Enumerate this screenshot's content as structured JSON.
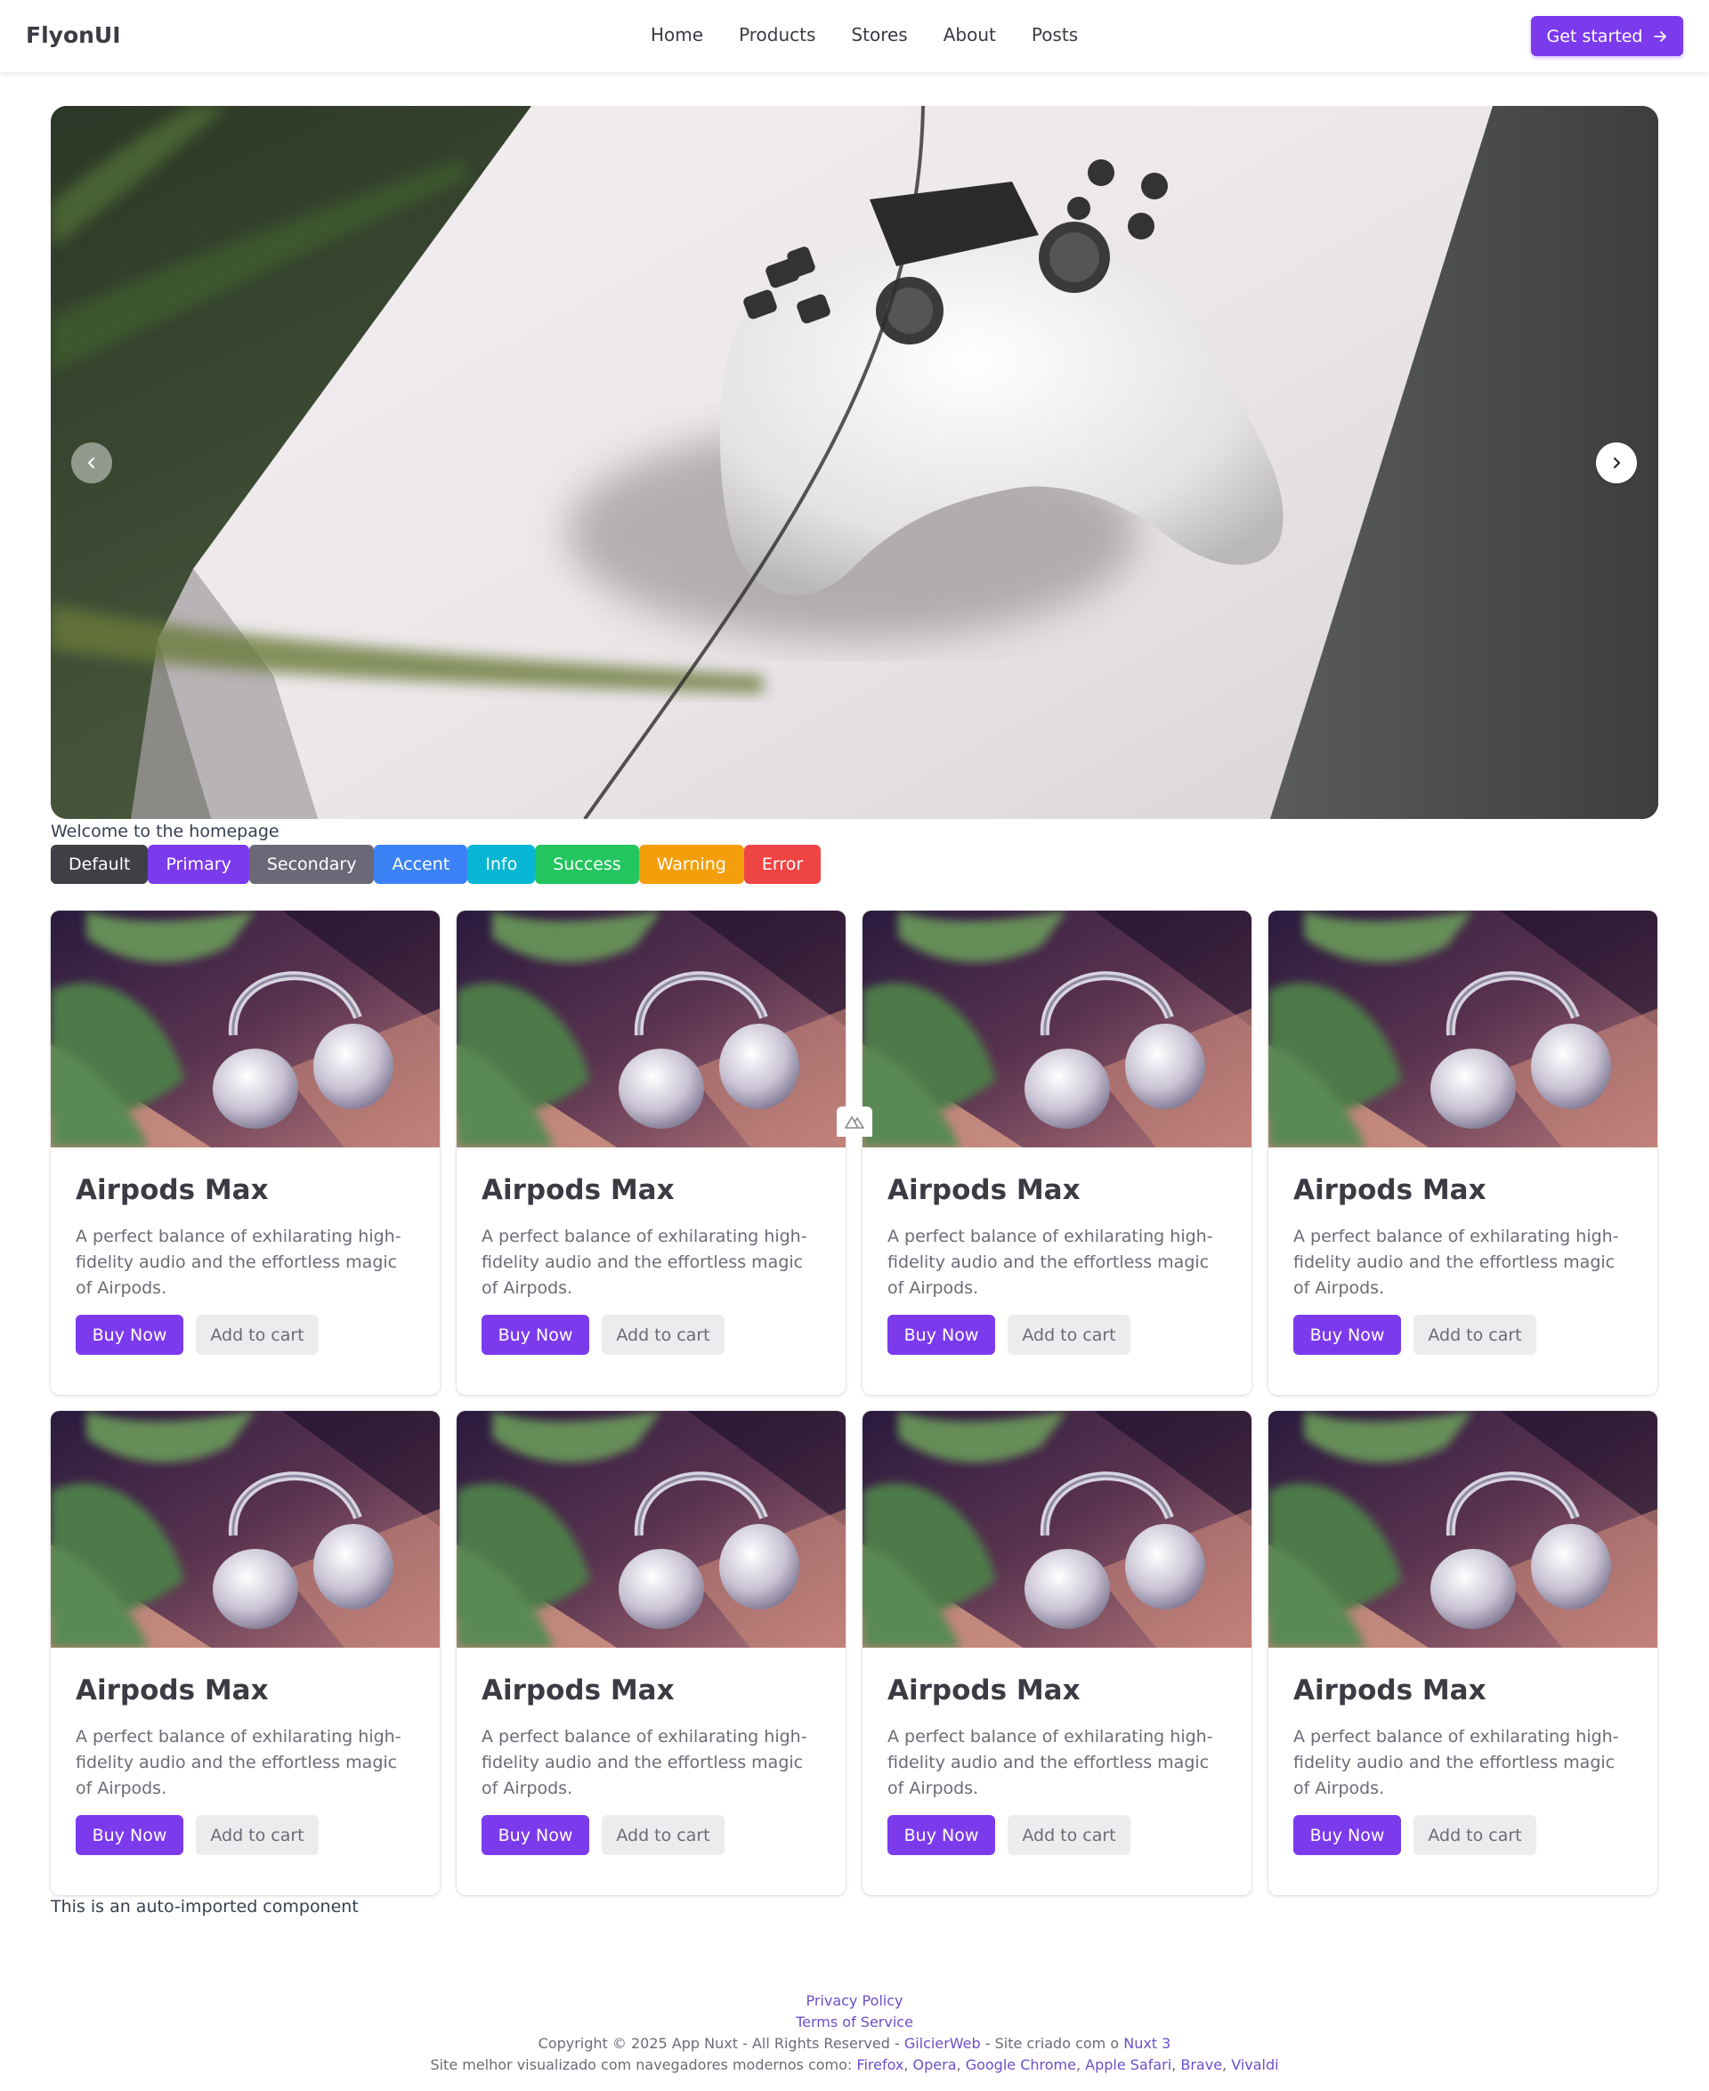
{
  "navbar": {
    "brand": "FlyonUI",
    "links": [
      "Home",
      "Products",
      "Stores",
      "About",
      "Posts"
    ],
    "cta_label": "Get started"
  },
  "hero": {
    "image_alt": "white game controller on console",
    "prev_icon": "chevron-left-icon",
    "next_icon": "chevron-right-icon"
  },
  "welcome_text": "Welcome to the homepage",
  "badges": [
    {
      "label": "Default",
      "color": "#3f3f46"
    },
    {
      "label": "Primary",
      "color": "#7c3aed"
    },
    {
      "label": "Secondary",
      "color": "#6b6878"
    },
    {
      "label": "Accent",
      "color": "#3b82f6"
    },
    {
      "label": "Info",
      "color": "#06b6d4"
    },
    {
      "label": "Success",
      "color": "#22c55e"
    },
    {
      "label": "Warning",
      "color": "#f59e0b"
    },
    {
      "label": "Error",
      "color": "#ef4444"
    }
  ],
  "products": [
    {
      "title": "Airpods Max",
      "description": "A perfect balance of exhilarating high-fidelity audio and the effortless magic of Airpods.",
      "buy_label": "Buy Now",
      "cart_label": "Add to cart"
    },
    {
      "title": "Airpods Max",
      "description": "A perfect balance of exhilarating high-fidelity audio and the effortless magic of Airpods.",
      "buy_label": "Buy Now",
      "cart_label": "Add to cart"
    },
    {
      "title": "Airpods Max",
      "description": "A perfect balance of exhilarating high-fidelity audio and the effortless magic of Airpods.",
      "buy_label": "Buy Now",
      "cart_label": "Add to cart"
    },
    {
      "title": "Airpods Max",
      "description": "A perfect balance of exhilarating high-fidelity audio and the effortless magic of Airpods.",
      "buy_label": "Buy Now",
      "cart_label": "Add to cart"
    },
    {
      "title": "Airpods Max",
      "description": "A perfect balance of exhilarating high-fidelity audio and the effortless magic of Airpods.",
      "buy_label": "Buy Now",
      "cart_label": "Add to cart"
    },
    {
      "title": "Airpods Max",
      "description": "A perfect balance of exhilarating high-fidelity audio and the effortless magic of Airpods.",
      "buy_label": "Buy Now",
      "cart_label": "Add to cart"
    },
    {
      "title": "Airpods Max",
      "description": "A perfect balance of exhilarating high-fidelity audio and the effortless magic of Airpods.",
      "buy_label": "Buy Now",
      "cart_label": "Add to cart"
    },
    {
      "title": "Airpods Max",
      "description": "A perfect balance of exhilarating high-fidelity audio and the effortless magic of Airpods.",
      "buy_label": "Buy Now",
      "cart_label": "Add to cart"
    }
  ],
  "auto_imported_text": "This is an auto-imported component",
  "footer": {
    "privacy": "Privacy Policy",
    "terms": "Terms of Service",
    "copyright_prefix": "Copyright © 2025 App Nuxt - All Rights Reserved - ",
    "author": "GilcierWeb",
    "built_with_prefix": " - Site criado com o ",
    "framework": "Nuxt 3",
    "browsers_prefix": "Site melhor visualizado com navegadores modernos como: ",
    "browsers": [
      "Firefox",
      "Opera",
      "Google Chrome",
      "Apple Safari",
      "Brave",
      "Vivaldi"
    ]
  },
  "colors": {
    "primary": "#7c3aed",
    "footer_link": "#6d4fc7"
  }
}
